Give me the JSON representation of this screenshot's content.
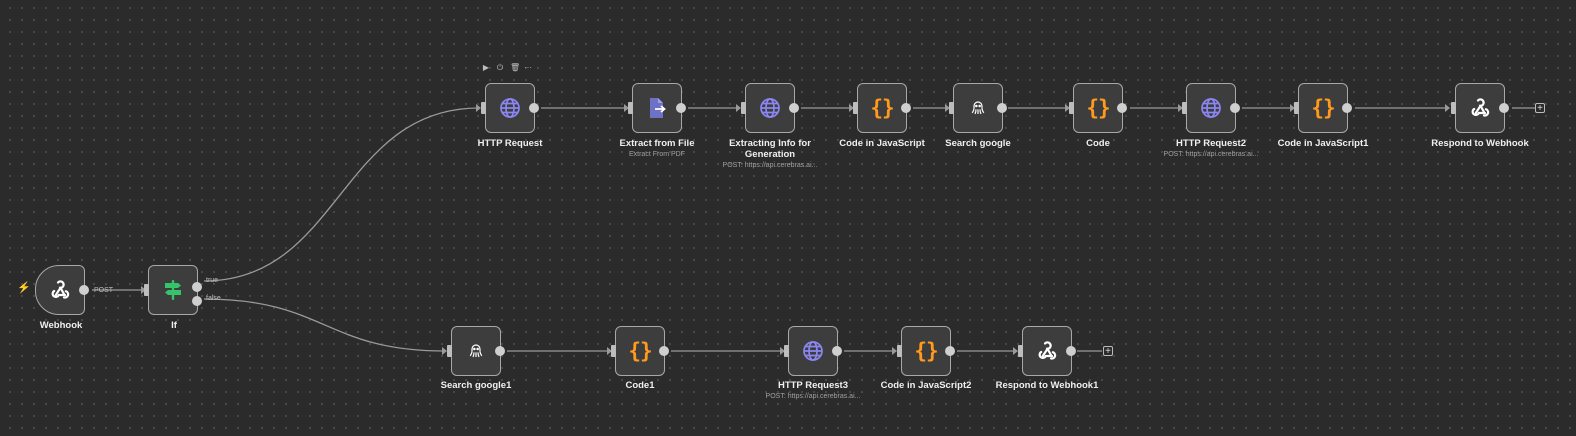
{
  "workflow": {
    "nodes": {
      "webhook": {
        "label": "Webhook",
        "icon": "webhook-icon"
      },
      "if": {
        "label": "If",
        "icon": "if-sign-icon"
      },
      "http_request": {
        "label": "HTTP Request",
        "icon": "globe-icon"
      },
      "extract_from_file": {
        "label": "Extract from File",
        "subtitle": "Extract From PDF",
        "icon": "file-extract-icon"
      },
      "extracting_info": {
        "label": "Extracting Info for Generation",
        "subtitle": "POST: https://api.cerebras.ai...",
        "icon": "globe-icon"
      },
      "code_in_javascript": {
        "label": "Code in JavaScript",
        "icon": "code-braces-icon"
      },
      "search_google": {
        "label": "Search google",
        "icon": "octopus-icon"
      },
      "code": {
        "label": "Code",
        "icon": "code-braces-icon"
      },
      "http_request2": {
        "label": "HTTP Request2",
        "subtitle": "POST: https://api.cerebras.ai...",
        "icon": "globe-icon"
      },
      "code_in_javascript1": {
        "label": "Code in JavaScript1",
        "icon": "code-braces-icon"
      },
      "respond_to_webhook": {
        "label": "Respond to Webhook",
        "icon": "webhook-icon"
      },
      "search_google1": {
        "label": "Search google1",
        "icon": "octopus-icon"
      },
      "code1": {
        "label": "Code1",
        "icon": "code-braces-icon"
      },
      "http_request3": {
        "label": "HTTP Request3",
        "subtitle": "POST: https://api.cerebras.ai...",
        "icon": "globe-icon"
      },
      "code_in_javascript2": {
        "label": "Code in JavaScript2",
        "icon": "code-braces-icon"
      },
      "respond_to_webhook1": {
        "label": "Respond to Webhook1",
        "icon": "webhook-icon"
      }
    },
    "edge_labels": {
      "post": "POST",
      "true": "true",
      "false": "false"
    },
    "code_glyph": "{}",
    "add_glyph": "+",
    "trigger_glyph": "⚡",
    "node_toolbar": {
      "play": "▶",
      "power": "⏻",
      "delete": "🗑",
      "more": "···"
    }
  },
  "colors": {
    "canvas_bg": "#2b2b2b",
    "node_bg": "#3d3d3d",
    "globe": "#8b86f0",
    "code": "#ff9a1f",
    "if": "#35c46a",
    "file": "#6d72c7",
    "trigger": "#ff6a3d",
    "connector": "#9a9a9a"
  }
}
